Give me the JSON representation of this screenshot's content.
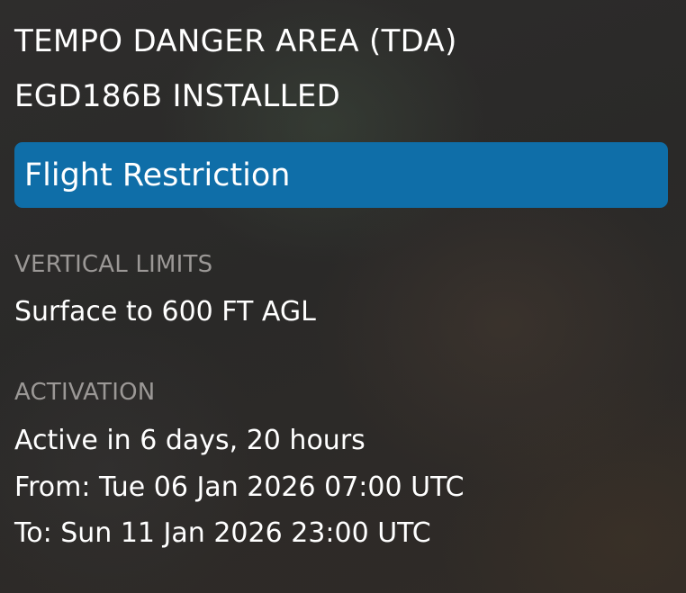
{
  "header": {
    "title_line1": "TEMPO DANGER AREA (TDA)",
    "title_line2": "EGD186B INSTALLED"
  },
  "restriction": {
    "type_label": "Flight Restriction",
    "color": "#0f6ea8"
  },
  "vertical_limits": {
    "label": "VERTICAL LIMITS",
    "value": "Surface to 600 FT AGL"
  },
  "activation": {
    "label": "ACTIVATION",
    "status": "Active in 6 days, 20 hours",
    "from": "From: Tue 06 Jan 2026 07:00 UTC",
    "to": "To: Sun 11 Jan 2026 23:00 UTC"
  }
}
